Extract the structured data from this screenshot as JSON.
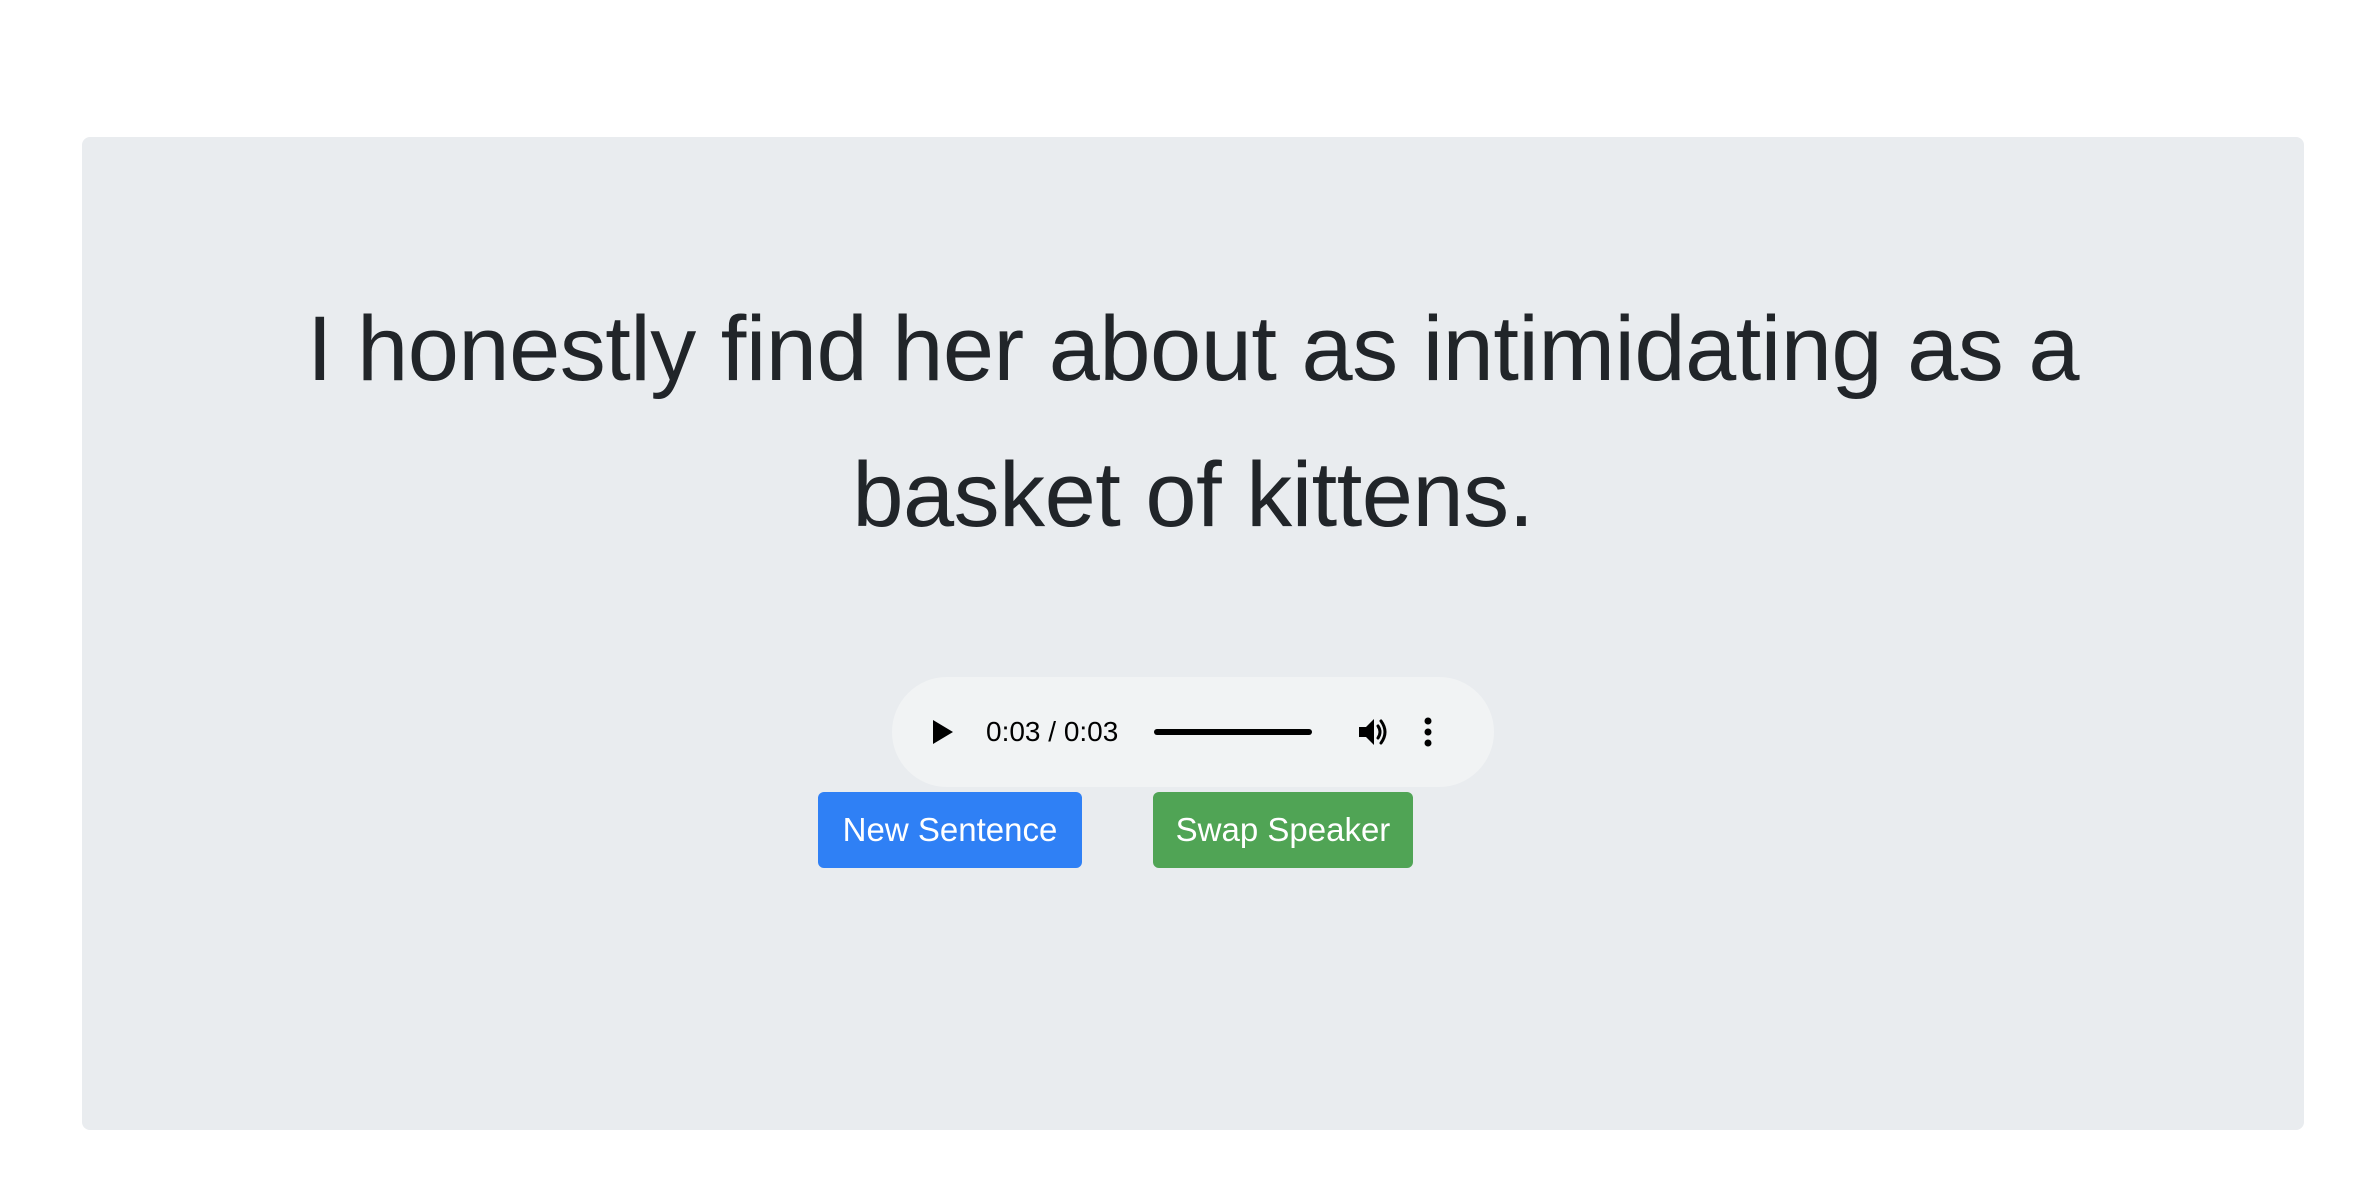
{
  "main": {
    "sentence": "I honestly find her about as intimidating as a basket of kittens."
  },
  "audio_player": {
    "time_display": "0:03 / 0:03",
    "progress_fraction": 1.0,
    "play_icon": "play-icon",
    "volume_icon": "volume-icon",
    "more_icon": "more-options-icon"
  },
  "buttons": {
    "new_sentence_label": "New Sentence",
    "swap_speaker_label": "Swap Speaker"
  },
  "colors": {
    "jumbotron_bg": "#e9ecef",
    "primary": "#2f80f5",
    "success": "#50a455",
    "text": "#212529"
  }
}
